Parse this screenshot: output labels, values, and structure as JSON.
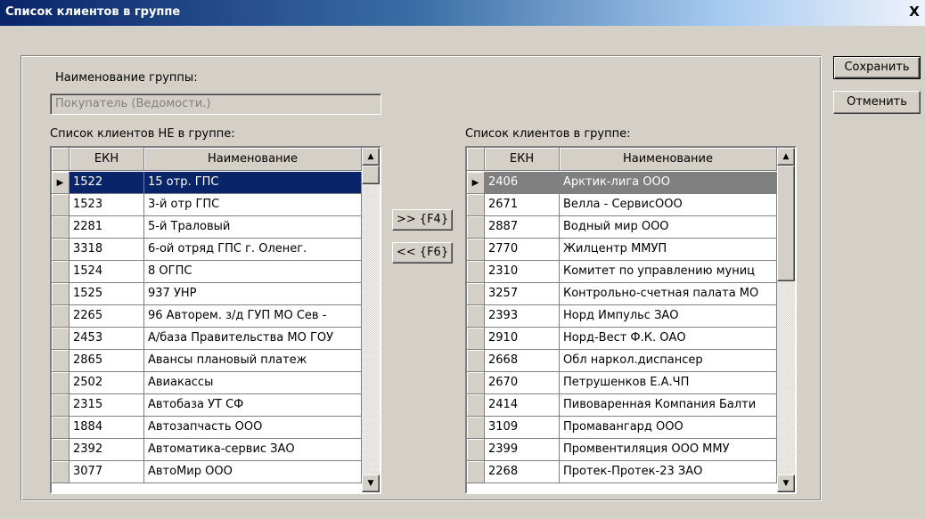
{
  "window": {
    "title": "Список клиентов в группе",
    "close_glyph": "X"
  },
  "group": {
    "label": "Наименование группы:",
    "value": "Покупатель (Ведомости.)"
  },
  "left_list": {
    "label": "Список клиентов НЕ в группе:",
    "columns": [
      "ЕКН",
      "Наименование"
    ],
    "selected_index": 0,
    "rows": [
      {
        "code": "1522",
        "name": "15 отр. ГПС"
      },
      {
        "code": "1523",
        "name": "3-й отр ГПС"
      },
      {
        "code": "2281",
        "name": "5-й  Траловый"
      },
      {
        "code": "3318",
        "name": "6-ой отряд ГПС г. Оленег."
      },
      {
        "code": "1524",
        "name": "8  ОГПС"
      },
      {
        "code": "1525",
        "name": "937 УНР"
      },
      {
        "code": "2265",
        "name": "96 Авторем. з/д  ГУП МО Сев -"
      },
      {
        "code": "2453",
        "name": "А/база Правительства МО ГОУ"
      },
      {
        "code": "2865",
        "name": "Авансы плановый платеж"
      },
      {
        "code": "2502",
        "name": "Авиакассы"
      },
      {
        "code": "2315",
        "name": "Автобаза  УТ  СФ"
      },
      {
        "code": "1884",
        "name": "Автозапчасть ООО"
      },
      {
        "code": "2392",
        "name": "Автоматика-сервис ЗАО"
      },
      {
        "code": "3077",
        "name": "АвтоМир ООО"
      }
    ]
  },
  "right_list": {
    "label": "Список клиентов в группе:",
    "columns": [
      "ЕКН",
      "Наименование"
    ],
    "selected_index": 0,
    "rows": [
      {
        "code": "2406",
        "name": "Арктик-лига ООО"
      },
      {
        "code": "2671",
        "name": "Велла - СервисООО"
      },
      {
        "code": "2887",
        "name": "Водный мир ООО"
      },
      {
        "code": "2770",
        "name": "Жилцентр ММУП"
      },
      {
        "code": "2310",
        "name": "Комитет по управлению муниц"
      },
      {
        "code": "3257",
        "name": "Контрольно-счетная палата МО"
      },
      {
        "code": "2393",
        "name": "Норд Импульс ЗАО"
      },
      {
        "code": "2910",
        "name": "Норд-Вест Ф.К. ОАО"
      },
      {
        "code": "2668",
        "name": "Обл наркол.диспансер"
      },
      {
        "code": "2670",
        "name": "Петрушенков Е.А.ЧП"
      },
      {
        "code": "2414",
        "name": "Пивоваренная Компания Балти"
      },
      {
        "code": "3109",
        "name": "Промавангард ООО"
      },
      {
        "code": "2399",
        "name": "Промвентиляция ООО ММУ"
      },
      {
        "code": "2268",
        "name": "Протек-Протек-23 ЗАО"
      }
    ]
  },
  "transfer": {
    "add_label": ">> {F4}",
    "remove_label": "<< {F6}"
  },
  "actions": {
    "save_label": "Сохранить",
    "cancel_label": "Отменить"
  },
  "icons": {
    "row_pointer": "row-pointer-icon",
    "scroll_up": "scroll-up-icon",
    "scroll_down": "scroll-down-icon"
  },
  "colors": {
    "title_start": "#0a246a",
    "title_end": "#a6caf0",
    "face": "#d4d0c8",
    "selection": "#0a246a",
    "inactive_selection": "#808080"
  }
}
